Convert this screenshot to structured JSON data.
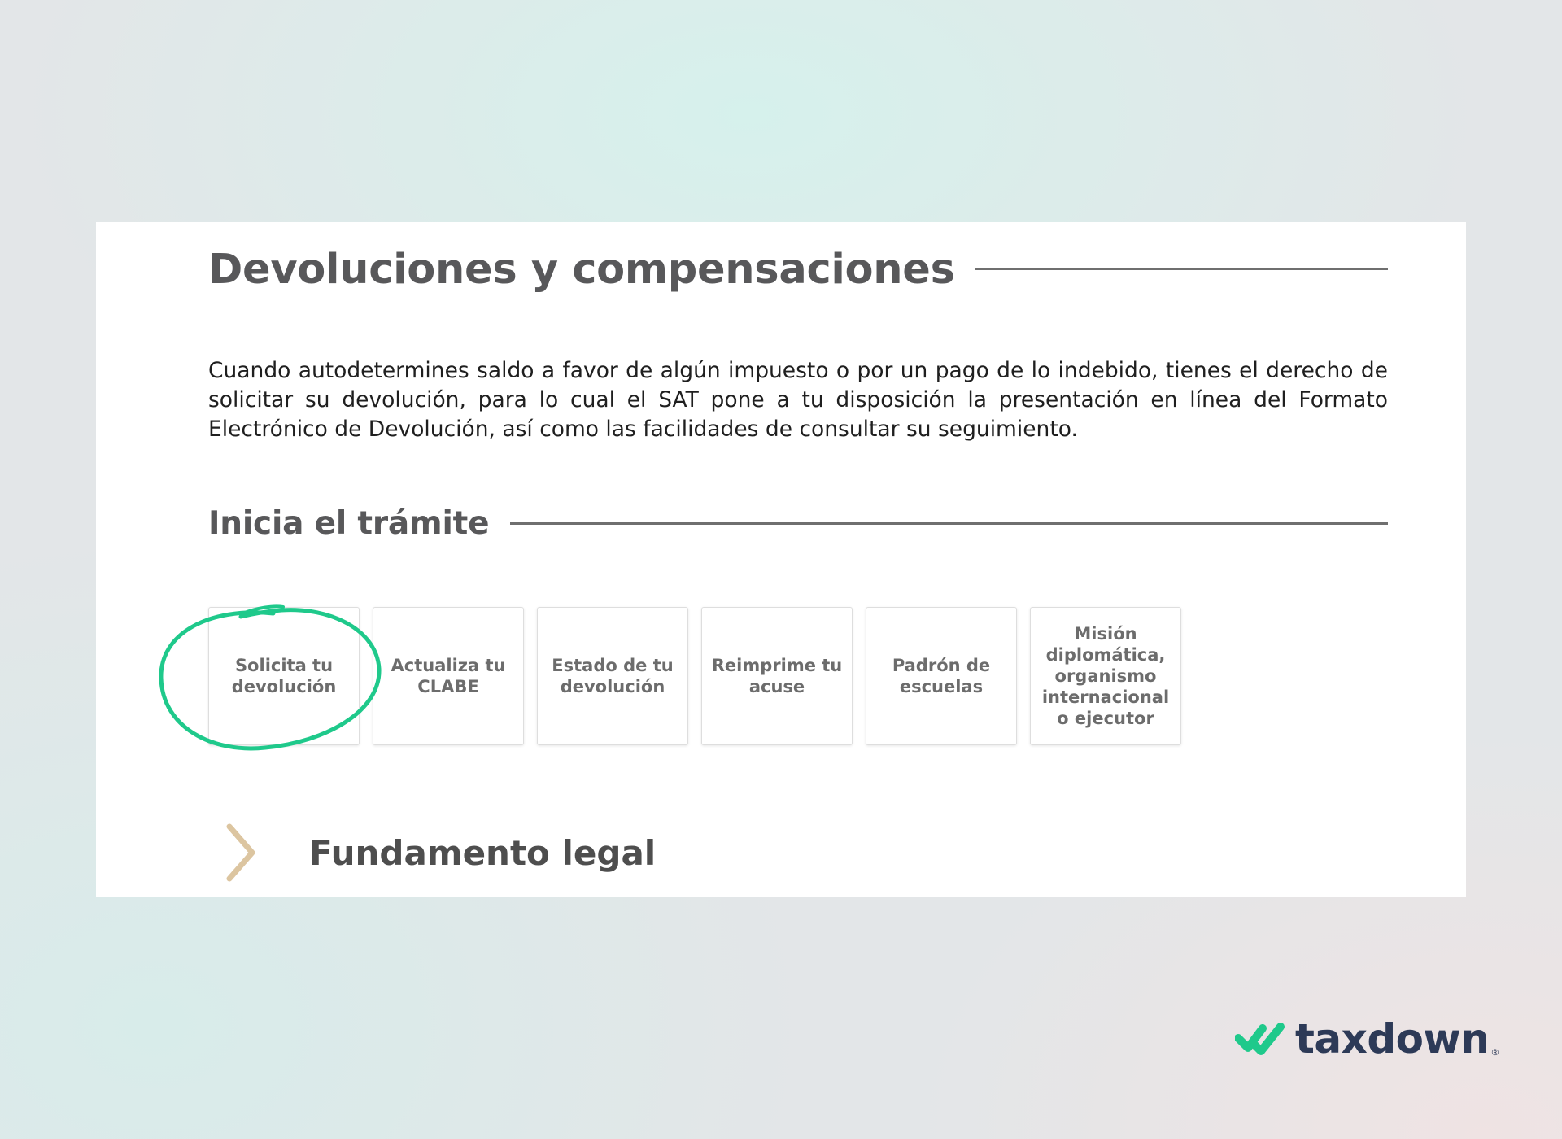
{
  "page": {
    "title": "Devoluciones y compensaciones",
    "intro": "Cuando autodetermines saldo a favor de algún impuesto o por un pago de lo indebido, tienes el derecho de solicitar su devolución, para lo cual el SAT pone a tu disposición la presentación en línea del Formato Electrónico de Devolución, así como las facilidades de consultar su seguimiento."
  },
  "tramite": {
    "heading": "Inicia el trámite",
    "cards": [
      {
        "label": "Solicita tu devolución",
        "highlighted": true
      },
      {
        "label": "Actualiza tu CLABE"
      },
      {
        "label": "Estado de tu devolución"
      },
      {
        "label": "Reimprime tu acuse"
      },
      {
        "label": "Padrón de escuelas"
      },
      {
        "label": "Misión diplomática, organismo internacional o ejecutor"
      }
    ]
  },
  "fundamento": {
    "label": "Fundamento legal",
    "icon": "chevron-right-icon"
  },
  "brand": {
    "name": "taxdown",
    "mark": "®"
  },
  "colors": {
    "highlight_circle": "#1fc98b",
    "chevron": "#dcc5a0",
    "heading_text": "#58585a",
    "brand_text": "#2d3a57",
    "brand_accent": "#1fc98b"
  }
}
